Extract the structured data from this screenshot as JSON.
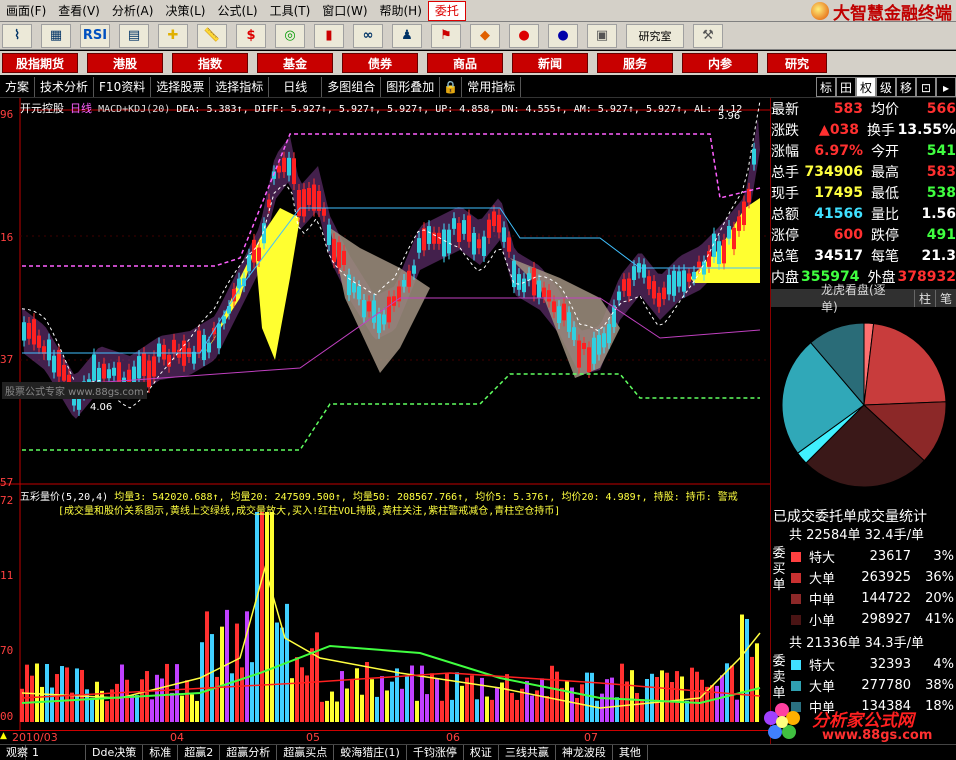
{
  "menu": {
    "items": [
      "画面(F)",
      "查看(V)",
      "分析(A)",
      "决策(L)",
      "公式(L)",
      "工具(T)",
      "窗口(W)",
      "帮助(H)",
      "委托"
    ],
    "brand": "大智慧金融终端"
  },
  "toolbar": {
    "rsi": "RSI",
    "research": "研究室"
  },
  "nav": [
    "股指期货",
    "港股",
    "指数",
    "基金",
    "债券",
    "商品",
    "新闻",
    "服务",
    "内参",
    "研究"
  ],
  "funcbar": {
    "left": [
      "方案",
      "技术分析",
      "F10资料",
      "选择股票",
      "选择指标",
      "日线",
      "多图组合",
      "图形叠加",
      "常用指标"
    ],
    "tabs": [
      "标",
      "田",
      "权",
      "级",
      "移"
    ]
  },
  "main_chart": {
    "title": "开元控股",
    "period": "日线",
    "indicator": "MACD+KDJ(20)",
    "legend": "DEA: 5.383↑, DIFF: 5.927↑, 5.927↑, 5.927↑, UP: 4.858, DN: 4.555↑, AM: 5.927↑, 5.927↑, AL: 4.12",
    "price_labels": [
      "96",
      "16",
      "37",
      "57"
    ],
    "high_label": "5.96",
    "low_label": "4.06",
    "watermark": "股票公式专家  www.88gs.com"
  },
  "volume_chart": {
    "title": "五彩量价(5,20,4)",
    "legend": "均量3: 542020.688↑, 均量20: 247509.500↑, 均量50: 208567.766↑, 均价5: 5.376↑, 均价20: 4.989↑, 持股: 持币: 警戒",
    "note": "[成交量和股价关系图示,黄线上交绿线,成交量放大,买入!红柱VOL持股,黄柱关注,紫柱警戒减仓,青柱空仓持币]",
    "volume_labels": [
      "72",
      "11",
      "70",
      "00"
    ],
    "date_labels": [
      "2010/03",
      "04",
      "05",
      "06",
      "07"
    ]
  },
  "quote": {
    "rows": [
      {
        "l1": "最新",
        "v1": "583",
        "l2": "均价",
        "v2": "566"
      },
      {
        "l1": "涨跌",
        "v1": "▲038",
        "l2": "换手",
        "v2": "13.55%"
      },
      {
        "l1": "涨幅",
        "v1": "6.97%",
        "l2": "今开",
        "v2": "541"
      },
      {
        "l1": "总手",
        "v1": "734906",
        "l2": "最高",
        "v2": "583"
      },
      {
        "l1": "现手",
        "v1": "17495",
        "l2": "最低",
        "v2": "538"
      },
      {
        "l1": "总额",
        "v1": "41566",
        "l2": "量比",
        "v2": "1.56"
      },
      {
        "l1": "涨停",
        "v1": "600",
        "l2": "跌停",
        "v2": "491"
      },
      {
        "l1": "总笔",
        "v1": "34517",
        "l2": "每笔",
        "v2": "21.3"
      },
      {
        "l1": "内盘",
        "v1": "355974",
        "l2": "外盘",
        "v2": "378932"
      }
    ],
    "colors": {
      "v1": [
        "#ff3030",
        "#ff3030",
        "#ff3030",
        "#ffff40",
        "#ffff40",
        "#40e0ff",
        "#ff3030",
        "#ffffff",
        "#40ff40"
      ],
      "v2": [
        "#ff3030",
        "#ffffff",
        "#40ff40",
        "#ff3030",
        "#40ff40",
        "#ffffff",
        "#40ff40",
        "#ffffff",
        "#ff3030"
      ]
    }
  },
  "lhk": {
    "title": "龙虎看盘(逐单)",
    "btn1": "柱",
    "btn2": "笔"
  },
  "stats": {
    "title": "已成交委托单成交量统计",
    "buy": {
      "head": "共 22584单 32.4手/单",
      "side": "委买单",
      "rows": [
        {
          "name": "特大",
          "val": "23617",
          "pct": "3%",
          "color": "#ff4040"
        },
        {
          "name": "大单",
          "val": "263925",
          "pct": "36%",
          "color": "#c83030"
        },
        {
          "name": "中单",
          "val": "144722",
          "pct": "20%",
          "color": "#8c2828"
        },
        {
          "name": "小单",
          "val": "298927",
          "pct": "41%",
          "color": "#4a1414"
        }
      ]
    },
    "sell": {
      "head": "共 21336单 34.3手/单",
      "side": "委卖单",
      "rows": [
        {
          "name": "特大",
          "val": "32393",
          "pct": "4%",
          "color": "#40e0ff"
        },
        {
          "name": "大单",
          "val": "277780",
          "pct": "38%",
          "color": "#30a0b0"
        },
        {
          "name": "中单",
          "val": "134384",
          "pct": "18%",
          "color": "#2a7080"
        }
      ]
    },
    "pie": [
      {
        "value": 3,
        "color": "#ff7070"
      },
      {
        "value": 36,
        "color": "#c83c3c"
      },
      {
        "value": 20,
        "color": "#8c2828"
      },
      {
        "value": 41,
        "color": "#3a1818"
      },
      {
        "value": 4,
        "color": "#40f0ff"
      },
      {
        "value": 38,
        "color": "#30a8b8"
      },
      {
        "value": 18,
        "color": "#2a6c78"
      }
    ]
  },
  "bottom_tabs": [
    "观察",
    "1",
    "Dde决策",
    "标准",
    "超赢2",
    "超赢分析",
    "超赢买点",
    "蛟海猎庄(1)",
    "千钧涨停",
    "权证",
    "三线共赢",
    "神龙波段",
    "其他"
  ],
  "watermark_logo": {
    "title": "分析家公式网",
    "url": "www.88gs.com"
  }
}
